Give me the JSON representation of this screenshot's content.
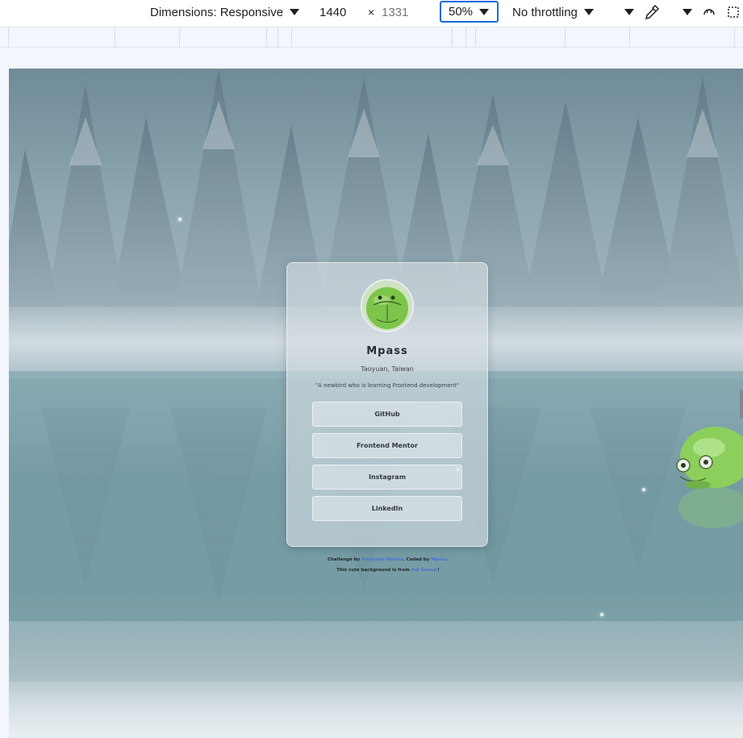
{
  "devtools": {
    "dimensions_label": "Dimensions: Responsive",
    "width_value": "1440",
    "times_sign": "×",
    "height_placeholder": "1331",
    "zoom": "50%",
    "throttling": "No throttling",
    "icons": [
      "dimensions-caret-icon",
      "zoom-caret-icon",
      "throttling-caret-icon",
      "more-caret-icon",
      "eyedropper-icon",
      "options-caret-icon",
      "rotate-icon",
      "device-frame-icon"
    ]
  },
  "profile": {
    "name": "Mpass",
    "location": "Taoyuan, Taiwan",
    "bio": "\"A newbird who is learning Frontend development\"",
    "links": [
      {
        "label": "GitHub"
      },
      {
        "label": "Frontend Mentor"
      },
      {
        "label": "Instagram"
      },
      {
        "label": "LinkedIn"
      }
    ]
  },
  "attribution": {
    "challenge_prefix": "Challenge by",
    "challenge_link": "Frontend Mentor",
    "coded_prefix": ". Coded by",
    "coded_link": "Mpass",
    "coded_suffix": ".",
    "bg_prefix": "This cute background is from",
    "bg_link": "Aqi Sousei",
    "bg_suffix": "!"
  },
  "colors": {
    "accent": "#1a6ad9",
    "link": "#4b6fd6",
    "avatar_green": "#7cc44a"
  }
}
